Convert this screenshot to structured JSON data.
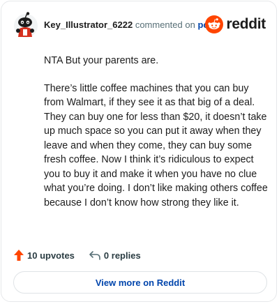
{
  "comment": {
    "author": "Key_Illustrator_6222",
    "action_text": "commented on",
    "post_link": "post",
    "paragraphs": [
      "NTA But your parents are.",
      "There’s little coffee machines that you can buy from Walmart, if they see it as that big of a deal. They can buy one for less than $20, it doesn’t take up much space so you can put it away when they leave and when they come, they can buy some fresh coffee. Now I think it’s ridiculous to expect you to buy it and make it when you have no clue what you’re doing. I don’t like making others coffee because I don’t know how strong they like it."
    ]
  },
  "brand": {
    "wordmark": "reddit",
    "icon": "reddit-snoo-icon",
    "color": "#ff4500"
  },
  "actions": {
    "upvotes_label": "10 upvotes",
    "upvote_icon": "upvote-arrow-icon",
    "upvote_color": "#ff4500",
    "replies_label": "0 replies",
    "reply_icon": "reply-arrow-icon"
  },
  "footer": {
    "view_more_label": "View more on Reddit"
  }
}
